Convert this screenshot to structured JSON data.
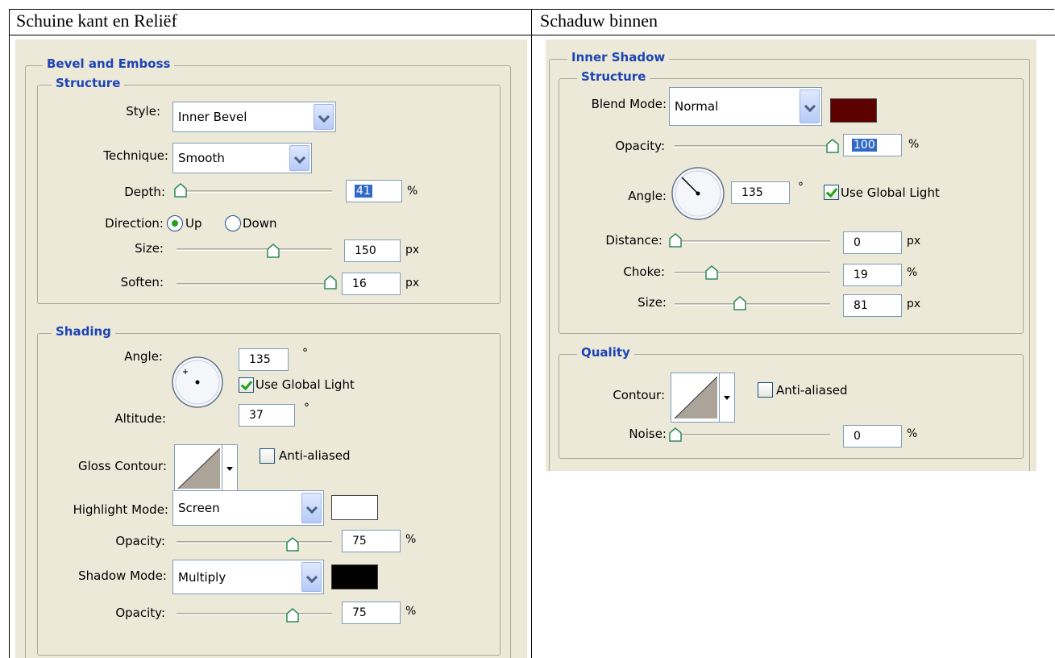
{
  "headers": {
    "left": "Schuine kant en Reliëf",
    "right": "Schaduw binnen"
  },
  "bevel": {
    "title": "Bevel and Emboss",
    "structure": {
      "title": "Structure",
      "style_label": "Style:",
      "style_value": "Inner Bevel",
      "technique_label": "Technique:",
      "technique_value": "Smooth",
      "depth_label": "Depth:",
      "depth_value": "41",
      "depth_unit": "%",
      "depth_slider": 0.0,
      "direction_label": "Direction:",
      "direction_up": "Up",
      "direction_down": "Down",
      "direction_selected": "Up",
      "size_label": "Size:",
      "size_value": "150",
      "size_unit": "px",
      "size_slider": 0.6,
      "soften_label": "Soften:",
      "soften_value": "16",
      "soften_unit": "px",
      "soften_slider": 1.0
    },
    "shading": {
      "title": "Shading",
      "angle_label": "Angle:",
      "angle_value": "135",
      "angle_unit": "°",
      "global_light_label": "Use Global Light",
      "global_light_checked": true,
      "altitude_label": "Altitude:",
      "altitude_value": "37",
      "altitude_unit": "°",
      "gloss_label": "Gloss Contour:",
      "antialias_label": "Anti-aliased",
      "antialias_checked": false,
      "highlight_label": "Highlight Mode:",
      "highlight_value": "Screen",
      "highlight_color": "#ffffff",
      "hl_opacity_label": "Opacity:",
      "hl_opacity_value": "75",
      "hl_opacity_unit": "%",
      "hl_opacity_slider": 0.75,
      "shadow_label": "Shadow Mode:",
      "shadow_value": "Multiply",
      "shadow_color": "#000000",
      "sh_opacity_label": "Opacity:",
      "sh_opacity_value": "75",
      "sh_opacity_unit": "%",
      "sh_opacity_slider": 0.75
    }
  },
  "inner": {
    "title": "Inner Shadow",
    "structure": {
      "title": "Structure",
      "blend_label": "Blend Mode:",
      "blend_value": "Normal",
      "blend_color": "#5c0000",
      "opacity_label": "Opacity:",
      "opacity_value": "100",
      "opacity_unit": "%",
      "opacity_slider": 1.0,
      "angle_label": "Angle:",
      "angle_value": "135",
      "angle_unit": "°",
      "global_light_label": "Use Global Light",
      "global_light_checked": true,
      "distance_label": "Distance:",
      "distance_value": "0",
      "distance_unit": "px",
      "distance_slider": 0.0,
      "choke_label": "Choke:",
      "choke_value": "19",
      "choke_unit": "%",
      "choke_slider": 0.19,
      "size_label": "Size:",
      "size_value": "81",
      "size_unit": "px",
      "size_slider": 0.33
    },
    "quality": {
      "title": "Quality",
      "contour_label": "Contour:",
      "antialias_label": "Anti-aliased",
      "antialias_checked": false,
      "noise_label": "Noise:",
      "noise_value": "0",
      "noise_unit": "%",
      "noise_slider": 0.0
    }
  }
}
